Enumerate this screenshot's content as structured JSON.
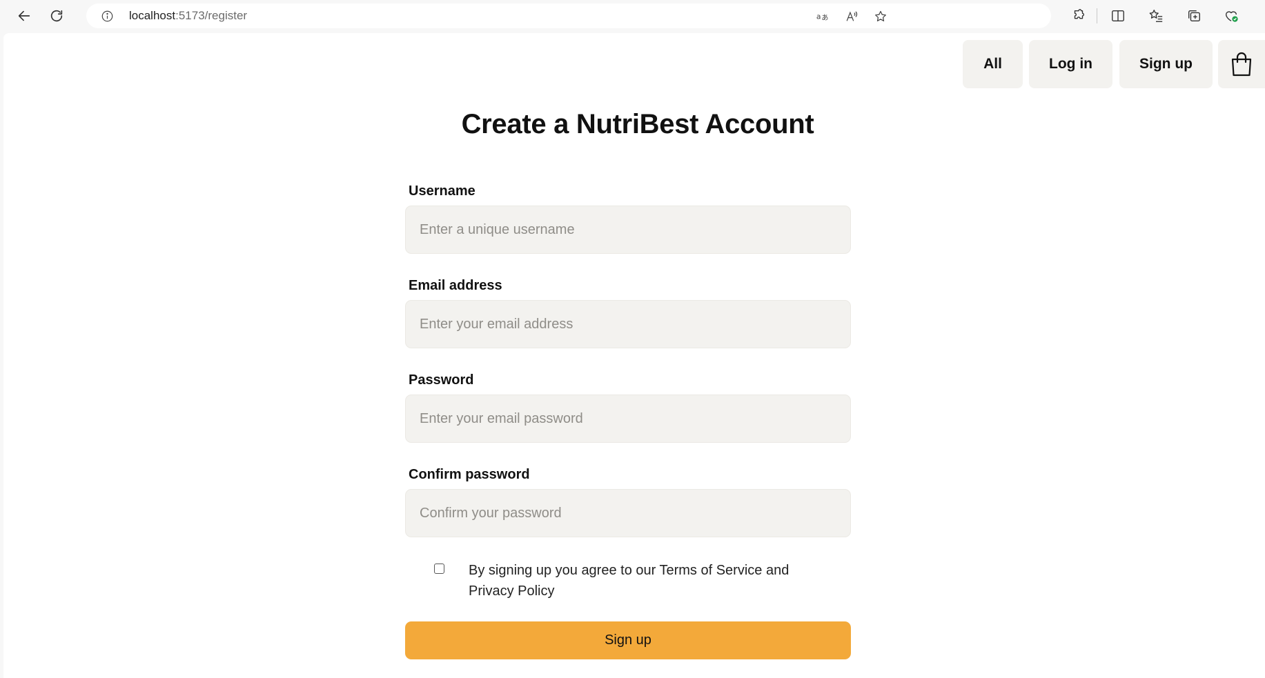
{
  "browser": {
    "url_host": "localhost",
    "url_path": ":5173/register"
  },
  "nav": {
    "all_label": "All",
    "login_label": "Log in",
    "signup_label": "Sign up",
    "cart_icon": "shopping-bag-icon"
  },
  "form": {
    "title": "Create a NutriBest Account",
    "username": {
      "label": "Username",
      "placeholder": "Enter a unique username",
      "value": ""
    },
    "email": {
      "label": "Email address",
      "placeholder": "Enter your email address",
      "value": ""
    },
    "password": {
      "label": "Password",
      "placeholder": "Enter your email password",
      "value": ""
    },
    "confirm_password": {
      "label": "Confirm password",
      "placeholder": "Confirm your password",
      "value": ""
    },
    "terms_text": "By signing up you agree to our Terms of Service and Privacy Policy",
    "terms_checked": false,
    "submit_label": "Sign up"
  },
  "colors": {
    "accent": "#f3a93a",
    "input_bg": "#f3f2ef"
  }
}
